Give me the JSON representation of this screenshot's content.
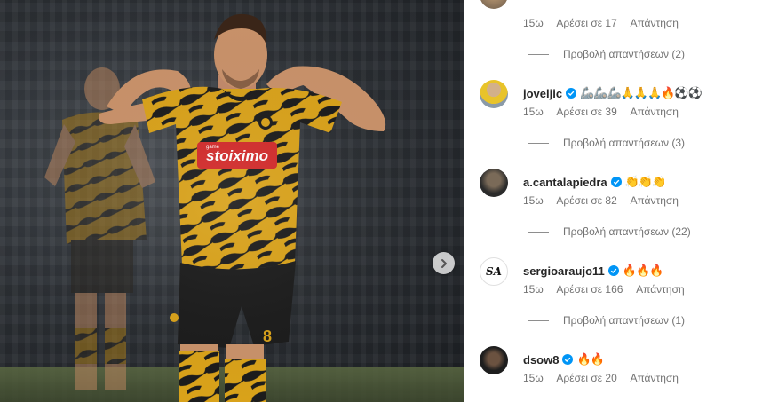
{
  "post": {
    "sponsor_text": "stoiximo",
    "sponsor_small": "game",
    "next_icon": "chevron-right-icon"
  },
  "comments_panel": {
    "top_partial": {
      "time": "15ω",
      "likes": "Αρέσει σε 17",
      "reply": "Απάντηση",
      "view_replies": "Προβολή απαντήσεων (2)"
    },
    "comments": [
      {
        "username": "joveljic",
        "verified": true,
        "text": "🦾🦾🦾🙏🙏🙏🔥⚽⚽",
        "time": "15ω",
        "likes": "Αρέσει σε 39",
        "reply": "Απάντηση",
        "view_replies": "Προβολή απαντήσεων (3)"
      },
      {
        "username": "a.cantalapiedra",
        "verified": true,
        "text": "👏👏👏",
        "time": "15ω",
        "likes": "Αρέσει σε 82",
        "reply": "Απάντηση",
        "view_replies": "Προβολή απαντήσεων (22)"
      },
      {
        "username": "sergioaraujo11",
        "verified": true,
        "text": "🔥🔥🔥",
        "time": "15ω",
        "likes": "Αρέσει σε 166",
        "reply": "Απάντηση",
        "view_replies": "Προβολή απαντήσεων (1)"
      },
      {
        "username": "dsow8",
        "verified": true,
        "text": "🔥🔥",
        "time": "15ω",
        "likes": "Αρέσει σε 20",
        "reply": "Απάντηση"
      }
    ],
    "avatar_monogram": "SA"
  },
  "colors": {
    "accent_verified": "#0095f6",
    "meta_text": "#737373",
    "jersey_yellow": "#d9a21a",
    "jersey_black": "#1c1c1c"
  }
}
